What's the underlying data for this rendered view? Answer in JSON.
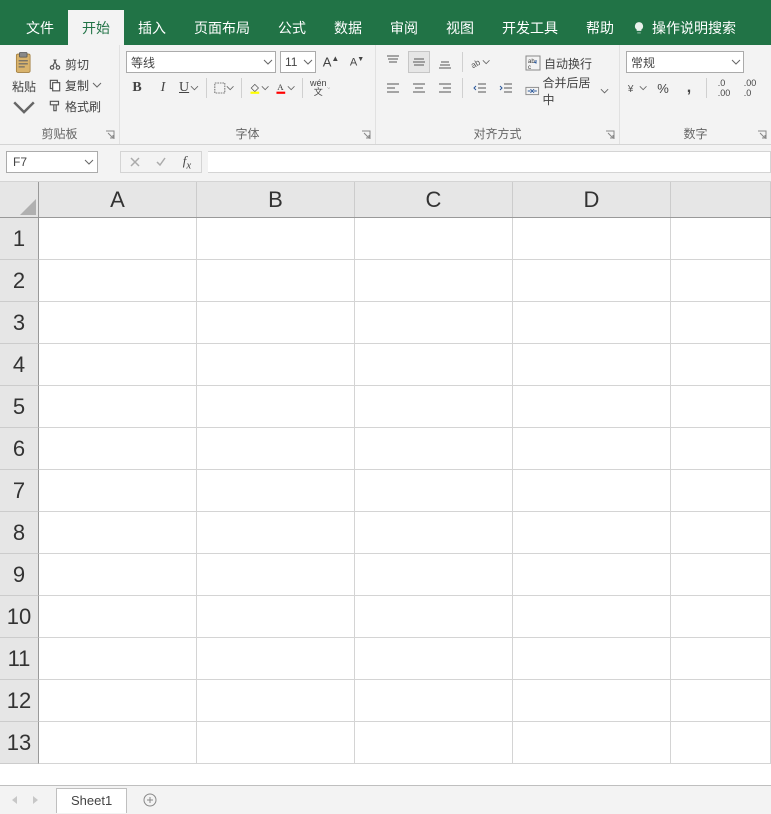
{
  "menu": {
    "tabs": [
      "文件",
      "开始",
      "插入",
      "页面布局",
      "公式",
      "数据",
      "审阅",
      "视图",
      "开发工具",
      "帮助"
    ],
    "active_index": 1,
    "search_label": "操作说明搜索"
  },
  "ribbon": {
    "clipboard": {
      "paste_label": "粘贴",
      "cut_label": "剪切",
      "copy_label": "复制",
      "formatpainter_label": "格式刷",
      "group_label": "剪贴板"
    },
    "font": {
      "font_name": "等线",
      "font_size": "11",
      "group_label": "字体"
    },
    "alignment": {
      "wrap_label": "自动换行",
      "merge_label": "合并后居中",
      "group_label": "对齐方式"
    },
    "number": {
      "format_name": "常规",
      "group_label": "数字"
    }
  },
  "formula_bar": {
    "name_box": "F7"
  },
  "grid": {
    "columns": [
      "A",
      "B",
      "C",
      "D"
    ],
    "rows": [
      "1",
      "2",
      "3",
      "4",
      "5",
      "6",
      "7",
      "8",
      "9",
      "10",
      "11",
      "12",
      "13"
    ]
  },
  "sheetbar": {
    "active_sheet": "Sheet1"
  }
}
